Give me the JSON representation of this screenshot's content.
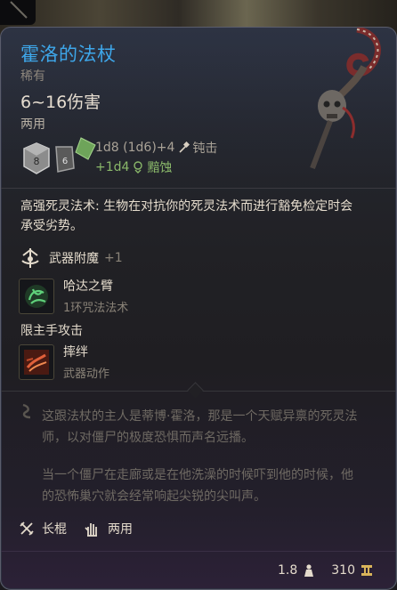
{
  "item": {
    "name": "霍洛的法杖",
    "rarity": "稀有",
    "damage": "6~16伤害",
    "handedness": "两用"
  },
  "damage_lines": {
    "main": "1d8 (1d6)+4",
    "main_type": "钝击",
    "bonus": "+1d4",
    "bonus_type": "黯蚀"
  },
  "dice": {
    "d8": "8",
    "d6": "6"
  },
  "description": "高强死灵法术: 生物在对抗你的死灵法术而进行豁免检定时会承受劣势。",
  "enchantment": {
    "label": "武器附魔",
    "value": "+1"
  },
  "actions": [
    {
      "name": "哈达之臂",
      "sub": "1环咒法法术"
    },
    {
      "name": "摔绊",
      "sub": "武器动作"
    }
  ],
  "offhand_label": "限主手攻击",
  "lore": [
    "这跟法杖的主人是蒂博·霍洛，那是一个天赋异禀的死灵法师，以对僵尸的极度恐惧而声名远播。",
    "当一个僵尸在走廊或是在他洗澡的时候吓到他的时候，他的恐怖巢穴就会经常响起尖锐的尖叫声。"
  ],
  "properties": [
    {
      "label": "长棍",
      "icon": "quarterstaff-icon"
    },
    {
      "label": "两用",
      "icon": "versatile-hand-icon"
    }
  ],
  "footer": {
    "weight": "1.8",
    "value": "310"
  },
  "colors": {
    "title": "#3ea7ea",
    "bonus_damage": "#8ab86a",
    "gold": "#d9b45a"
  }
}
